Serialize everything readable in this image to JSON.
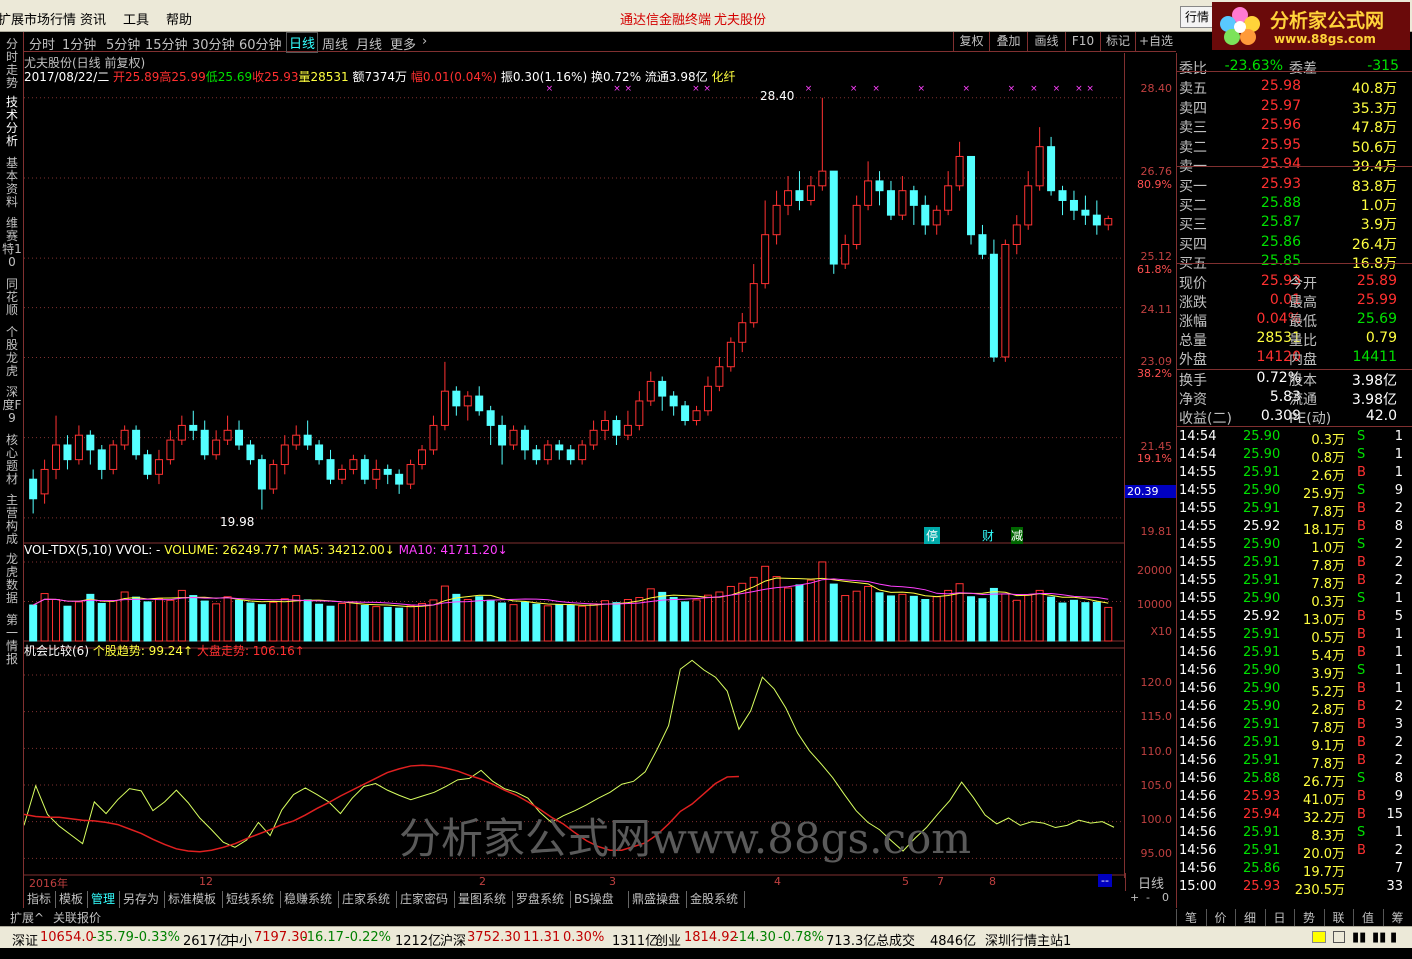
{
  "menu": {
    "items": [
      "扩展市场行情",
      "资讯",
      "工具",
      "帮助"
    ],
    "center_left": "通达信金融终端",
    "center_right": "尤夫股份",
    "quote_button": "行情"
  },
  "logo": {
    "title": "分析家公式网",
    "url": "www.88gs.com"
  },
  "left_tabs": [
    "分时走势",
    "技术分析",
    "基本资料",
    "维赛特10",
    "同花顺",
    "个股龙虎",
    "深度F9",
    "核心题材",
    "主营构成",
    "龙虎数据",
    "第一情报"
  ],
  "period_tabs": [
    "分时",
    "1分钟",
    "5分钟",
    "15分钟",
    "30分钟",
    "60分钟",
    "日线",
    "周线",
    "月线",
    "更多"
  ],
  "active_period": "日线",
  "tool_buttons": [
    "复权",
    "叠加",
    "画线",
    "F10",
    "标记",
    "+自选"
  ],
  "chart_title": "尤夫股份(日线 前复权)",
  "info_line": {
    "date": "2017/08/22/二",
    "open": "开25.89",
    "high": "高25.99",
    "low": "低25.69",
    "close": "收25.93",
    "vol": "量28531",
    "amt": "额7374万",
    "range": "幅0.01(0.04%)",
    "amp": "振0.30(1.16%)",
    "turn": "换0.72%",
    "float": "流通3.98亿",
    "concept": "化纤"
  },
  "price_axis": [
    "28.40",
    "26.76",
    "25.12",
    "24.11",
    "23.09",
    "21.45",
    "19.81"
  ],
  "fib_axis": [
    "80.9%",
    "61.8%",
    "38.2%",
    "19.1%"
  ],
  "current_price_tag": "20.39",
  "annotations": {
    "high": "28.40",
    "low": "19.98",
    "events": [
      "停",
      "财",
      "减"
    ]
  },
  "vol_header": {
    "name": "VOL-TDX(5,10)",
    "vvol": "VVOL: -",
    "volume": "VOLUME: 26249.77↑",
    "ma5": "MA5: 34212.00↓",
    "ma10": "MA10: 41711.20↓"
  },
  "vol_axis": [
    "20000",
    "10000",
    "X10"
  ],
  "ind_header": {
    "name": "机会比较(6)",
    "stock": "个股趋势: 99.24↑",
    "market": "大盘走势: 106.16↑"
  },
  "ind_axis": [
    "120.0",
    "115.0",
    "110.0",
    "105.0",
    "100.0",
    "95.00"
  ],
  "watermark": "分析家公式网www.88gs.com",
  "date_axis": [
    "2016年",
    "12",
    "2",
    "3",
    "4",
    "5",
    "7",
    "8"
  ],
  "bottom_tabs": [
    "指标",
    "模板",
    "管理",
    "另存为",
    "标准模板",
    "短线系统",
    "稳赚系统",
    "庄家系统",
    "庄家密码",
    "量图系统",
    "罗盘系统",
    "BS操盘",
    "鼎盛操盘",
    "金股系统"
  ],
  "active_bottom_tab": "管理",
  "ext_tabs": [
    "扩展^",
    "关联报价"
  ],
  "day_label": "日线",
  "order_book": {
    "weibi": {
      "label": "委比",
      "value": "-23.63%",
      "label2": "委差",
      "value2": "-315"
    },
    "sells": [
      {
        "name": "卖五",
        "price": "25.98",
        "vol": "40.8万"
      },
      {
        "name": "卖四",
        "price": "25.97",
        "vol": "35.3万"
      },
      {
        "name": "卖三",
        "price": "25.96",
        "vol": "47.8万"
      },
      {
        "name": "卖二",
        "price": "25.95",
        "vol": "50.6万"
      },
      {
        "name": "卖一",
        "price": "25.94",
        "vol": "39.4万"
      }
    ],
    "buys": [
      {
        "name": "买一",
        "price": "25.93",
        "vol": "83.8万"
      },
      {
        "name": "买二",
        "price": "25.88",
        "vol": "1.0万"
      },
      {
        "name": "买三",
        "price": "25.87",
        "vol": "3.9万"
      },
      {
        "name": "买四",
        "price": "25.86",
        "vol": "26.4万"
      },
      {
        "name": "买五",
        "price": "25.85",
        "vol": "16.8万"
      }
    ]
  },
  "quote": [
    {
      "l": "现价",
      "v": "25.93",
      "l2": "今开",
      "v2": "25.89"
    },
    {
      "l": "涨跌",
      "v": "0.01",
      "l2": "最高",
      "v2": "25.99"
    },
    {
      "l": "涨幅",
      "v": "0.04%",
      "l2": "最低",
      "v2": "25.69"
    },
    {
      "l": "总量",
      "v": "28531",
      "l2": "量比",
      "v2": "0.79"
    },
    {
      "l": "外盘",
      "v": "14120",
      "l2": "内盘",
      "v2": "14411"
    }
  ],
  "fund": [
    {
      "l": "换手",
      "v": "0.72%",
      "l2": "股本",
      "v2": "3.98亿"
    },
    {
      "l": "净资",
      "v": "5.83",
      "l2": "流通",
      "v2": "3.98亿"
    },
    {
      "l": "收益(二)",
      "v": "0.309",
      "l2": "PE(动)",
      "v2": "42.0"
    }
  ],
  "ticks": [
    [
      "14:54",
      "25.90",
      "0.3万",
      "S",
      "1"
    ],
    [
      "14:54",
      "25.90",
      "0.8万",
      "S",
      "1"
    ],
    [
      "14:55",
      "25.91",
      "2.6万",
      "B",
      "1"
    ],
    [
      "14:55",
      "25.90",
      "25.9万",
      "S",
      "9"
    ],
    [
      "14:55",
      "25.91",
      "7.8万",
      "B",
      "2"
    ],
    [
      "14:55",
      "25.92",
      "18.1万",
      "B",
      "8"
    ],
    [
      "14:55",
      "25.90",
      "1.0万",
      "S",
      "2"
    ],
    [
      "14:55",
      "25.91",
      "7.8万",
      "B",
      "2"
    ],
    [
      "14:55",
      "25.91",
      "7.8万",
      "B",
      "2"
    ],
    [
      "14:55",
      "25.90",
      "0.3万",
      "S",
      "1"
    ],
    [
      "14:55",
      "25.92",
      "13.0万",
      "B",
      "5"
    ],
    [
      "14:55",
      "25.91",
      "0.5万",
      "B",
      "1"
    ],
    [
      "14:56",
      "25.91",
      "5.4万",
      "B",
      "1"
    ],
    [
      "14:56",
      "25.90",
      "3.9万",
      "S",
      "1"
    ],
    [
      "14:56",
      "25.90",
      "5.2万",
      "B",
      "1"
    ],
    [
      "14:56",
      "25.90",
      "2.8万",
      "B",
      "2"
    ],
    [
      "14:56",
      "25.91",
      "7.8万",
      "B",
      "3"
    ],
    [
      "14:56",
      "25.91",
      "9.1万",
      "B",
      "2"
    ],
    [
      "14:56",
      "25.91",
      "7.8万",
      "B",
      "2"
    ],
    [
      "14:56",
      "25.88",
      "26.7万",
      "S",
      "8"
    ],
    [
      "14:56",
      "25.93",
      "41.0万",
      "B",
      "9"
    ],
    [
      "14:56",
      "25.94",
      "32.2万",
      "B",
      "15"
    ],
    [
      "14:56",
      "25.91",
      "8.3万",
      "S",
      "1"
    ],
    [
      "14:56",
      "25.91",
      "20.0万",
      "B",
      "2"
    ],
    [
      "14:56",
      "25.86",
      "19.7万",
      "",
      "7"
    ],
    [
      "15:00",
      "25.93",
      "230.5万",
      "",
      "33"
    ]
  ],
  "right_bottom_tabs": [
    "笔",
    "价",
    "细",
    "日",
    "势",
    "联",
    "值",
    "筹"
  ],
  "status": {
    "sz": {
      "name": "深证",
      "v": "10654.0",
      "c": "-35.79",
      "p": "-0.33%",
      "a": "2617亿"
    },
    "zx": {
      "name": "中小",
      "v": "7197.30",
      "c": "-16.17",
      "p": "-0.22%",
      "a": "1212亿"
    },
    "hs": {
      "name": "沪深",
      "v": "3752.30",
      "c": "11.31",
      "p": "0.30%",
      "a": "1311亿"
    },
    "cy": {
      "name": "创业",
      "v": "1814.92",
      "c": "-14.30",
      "p": "-0.78%",
      "a": "713.3亿"
    },
    "total": {
      "name": "总成交",
      "a": "4846亿"
    },
    "station": "深圳行情主站1"
  },
  "chart_data": {
    "type": "candlestick",
    "title": "尤夫股份(日线 前复权)",
    "price_range": [
      19.5,
      28.6
    ],
    "candles": [
      [
        20.6,
        20.2,
        20.8,
        19.9
      ],
      [
        20.3,
        20.8,
        21.0,
        20.1
      ],
      [
        20.8,
        21.3,
        21.9,
        20.6
      ],
      [
        21.3,
        21.0,
        21.5,
        20.8
      ],
      [
        21.0,
        21.5,
        21.7,
        20.9
      ],
      [
        21.5,
        21.2,
        21.6,
        20.9
      ],
      [
        21.2,
        20.8,
        21.3,
        20.6
      ],
      [
        20.8,
        21.3,
        21.4,
        20.7
      ],
      [
        21.3,
        21.6,
        21.7,
        21.2
      ],
      [
        21.6,
        21.1,
        21.7,
        21.0
      ],
      [
        21.1,
        20.7,
        21.2,
        20.6
      ],
      [
        20.7,
        21.0,
        21.2,
        20.5
      ],
      [
        21.0,
        21.4,
        21.6,
        20.9
      ],
      [
        21.4,
        21.7,
        21.9,
        21.3
      ],
      [
        21.7,
        21.6,
        22.0,
        21.4
      ],
      [
        21.6,
        21.1,
        21.8,
        21.0
      ],
      [
        21.1,
        21.4,
        21.6,
        21.0
      ],
      [
        21.4,
        21.6,
        21.9,
        21.3
      ],
      [
        21.6,
        21.3,
        21.8,
        21.2
      ],
      [
        21.3,
        21.0,
        21.4,
        20.9
      ],
      [
        21.0,
        20.4,
        21.1,
        19.98
      ],
      [
        20.4,
        20.9,
        21.0,
        20.3
      ],
      [
        20.9,
        21.3,
        21.5,
        20.7
      ],
      [
        21.3,
        21.5,
        21.7,
        21.2
      ],
      [
        21.5,
        21.3,
        21.8,
        21.2
      ],
      [
        21.3,
        21.0,
        21.4,
        20.9
      ],
      [
        21.0,
        20.6,
        21.2,
        20.5
      ],
      [
        20.6,
        20.8,
        20.9,
        20.5
      ],
      [
        20.8,
        21.0,
        21.1,
        20.7
      ],
      [
        21.0,
        20.6,
        21.1,
        20.5
      ],
      [
        20.6,
        20.8,
        21.0,
        20.4
      ],
      [
        20.8,
        20.7,
        20.9,
        20.5
      ],
      [
        20.7,
        20.5,
        20.8,
        20.3
      ],
      [
        20.5,
        20.9,
        21.0,
        20.4
      ],
      [
        20.9,
        21.2,
        21.3,
        20.8
      ],
      [
        21.2,
        21.7,
        21.9,
        21.1
      ],
      [
        21.7,
        22.4,
        23.0,
        21.6
      ],
      [
        22.4,
        22.1,
        22.5,
        21.9
      ],
      [
        22.1,
        22.3,
        22.4,
        21.8
      ],
      [
        22.3,
        22.0,
        22.5,
        21.9
      ],
      [
        22.0,
        21.7,
        22.1,
        21.3
      ],
      [
        21.7,
        21.3,
        21.9,
        20.9
      ],
      [
        21.3,
        21.6,
        21.7,
        21.2
      ],
      [
        21.6,
        21.2,
        21.7,
        21.0
      ],
      [
        21.2,
        21.0,
        21.3,
        20.9
      ],
      [
        21.0,
        21.3,
        21.4,
        20.9
      ],
      [
        21.3,
        21.2,
        21.4,
        21.0
      ],
      [
        21.2,
        21.0,
        21.3,
        20.9
      ],
      [
        21.0,
        21.3,
        21.4,
        20.9
      ],
      [
        21.3,
        21.6,
        21.8,
        21.2
      ],
      [
        21.6,
        21.8,
        22.0,
        21.4
      ],
      [
        21.8,
        21.5,
        21.9,
        21.3
      ],
      [
        21.5,
        21.7,
        22.0,
        21.4
      ],
      [
        21.7,
        22.2,
        22.4,
        21.6
      ],
      [
        22.2,
        22.6,
        22.8,
        22.1
      ],
      [
        22.6,
        22.3,
        22.7,
        22.0
      ],
      [
        22.3,
        22.1,
        22.4,
        21.9
      ],
      [
        22.1,
        21.8,
        22.2,
        21.7
      ],
      [
        21.8,
        22.0,
        22.1,
        21.7
      ],
      [
        22.0,
        22.5,
        22.7,
        21.9
      ],
      [
        22.5,
        22.9,
        23.1,
        22.4
      ],
      [
        22.9,
        23.4,
        23.5,
        22.8
      ],
      [
        23.4,
        23.8,
        24.0,
        23.2
      ],
      [
        23.8,
        24.6,
        25.0,
        23.7
      ],
      [
        24.6,
        25.6,
        26.3,
        24.5
      ],
      [
        25.6,
        26.2,
        26.5,
        25.4
      ],
      [
        26.2,
        26.5,
        26.8,
        26.0
      ],
      [
        26.5,
        26.3,
        26.9,
        26.1
      ],
      [
        26.3,
        26.6,
        26.8,
        26.2
      ],
      [
        26.6,
        26.9,
        28.4,
        26.5
      ],
      [
        26.9,
        25.0,
        26.9,
        24.8
      ],
      [
        25.0,
        25.4,
        25.6,
        24.9
      ],
      [
        25.4,
        26.2,
        26.4,
        25.3
      ],
      [
        26.2,
        26.7,
        27.1,
        26.1
      ],
      [
        26.7,
        26.5,
        26.9,
        26.2
      ],
      [
        26.5,
        26.0,
        26.7,
        25.9
      ],
      [
        26.0,
        26.5,
        26.8,
        25.9
      ],
      [
        26.5,
        26.2,
        26.6,
        25.8
      ],
      [
        26.2,
        25.8,
        26.4,
        25.6
      ],
      [
        25.8,
        26.1,
        26.2,
        25.6
      ],
      [
        26.1,
        26.6,
        26.9,
        26.0
      ],
      [
        26.6,
        27.2,
        27.5,
        26.5
      ],
      [
        27.2,
        25.6,
        27.2,
        25.4
      ],
      [
        25.6,
        25.2,
        25.8,
        25.1
      ],
      [
        25.2,
        23.1,
        25.5,
        23.0
      ],
      [
        23.1,
        25.4,
        25.5,
        23.0
      ],
      [
        25.4,
        25.8,
        26.0,
        25.2
      ],
      [
        25.8,
        26.6,
        26.9,
        25.7
      ],
      [
        26.6,
        27.4,
        27.8,
        26.5
      ],
      [
        27.4,
        26.5,
        27.6,
        26.4
      ],
      [
        26.5,
        26.3,
        26.6,
        26.0
      ],
      [
        26.3,
        26.1,
        26.5,
        25.9
      ],
      [
        26.1,
        26.0,
        26.4,
        25.8
      ],
      [
        26.0,
        25.8,
        26.3,
        25.6
      ],
      [
        25.8,
        25.93,
        25.99,
        25.69
      ]
    ],
    "volume": [
      9100,
      12000,
      10500,
      8800,
      9900,
      11800,
      9500,
      10200,
      12400,
      11100,
      9900,
      10700,
      10300,
      12800,
      11500,
      10100,
      9400,
      11200,
      10300,
      9600,
      9200,
      9800,
      10700,
      11500,
      10400,
      9300,
      8800,
      9500,
      9900,
      9000,
      8700,
      8500,
      8300,
      8900,
      9500,
      10400,
      13900,
      11800,
      10500,
      11200,
      10300,
      9600,
      9200,
      9800,
      9300,
      8900,
      9200,
      9000,
      8800,
      9400,
      10200,
      9700,
      10500,
      11000,
      13200,
      12300,
      11000,
      9900,
      10400,
      11600,
      12400,
      13800,
      14600,
      16100,
      18900,
      16300,
      13400,
      14200,
      15400,
      20000,
      14400,
      11500,
      12600,
      13800,
      12200,
      11400,
      11800,
      11300,
      10500,
      11200,
      12800,
      14500,
      11200,
      10700,
      13300,
      11900,
      10300,
      11600,
      12800,
      11100,
      9600,
      10300,
      9700,
      9800,
      8500
    ],
    "opportunity_stock": [
      99.5,
      104.9,
      101.0,
      99.4,
      98.2,
      97.0,
      102.7,
      101.1,
      103.0,
      104.5,
      104.2,
      101.5,
      102.7,
      104.3,
      102.6,
      100.5,
      98.9,
      97.2,
      96.5,
      97.5,
      99.9,
      98.1,
      101.6,
      103.7,
      104.6,
      103.7,
      102.7,
      101.1,
      103.2,
      104.8,
      105.2,
      104.3,
      103.6,
      103.0,
      103.5,
      104.0,
      104.8,
      105.7,
      105.9,
      107.0,
      105.5,
      104.5,
      104.0,
      103.2,
      101.3,
      99.9,
      100.8,
      101.5,
      102.3,
      103.2,
      104.0,
      105.1,
      105.5,
      106.8,
      109.8,
      113.1,
      120.8,
      122.0,
      120.7,
      119.7,
      117.8,
      112.6,
      115.1,
      119.7,
      118.1,
      115.5,
      112.1,
      109.7,
      107.9,
      106.0,
      103.7,
      101.5,
      99.9,
      98.9,
      97.4,
      96.0,
      97.7,
      99.2,
      101.1,
      102.9,
      105.4,
      103.3,
      100.9,
      99.7,
      100.5,
      99.5,
      100.0,
      99.8,
      99.2,
      99.5,
      100.2,
      99.8,
      100.0,
      99.24
    ],
    "opportunity_market": [
      101.0,
      100.7,
      100.6,
      100.6,
      100.4,
      100.2,
      100.1,
      99.9,
      99.6,
      99.0,
      98.4,
      97.6,
      96.9,
      96.3,
      96.0,
      95.9,
      96.1,
      96.5,
      97.0,
      97.7,
      98.3,
      98.9,
      99.6,
      100.1,
      100.9,
      101.8,
      102.6,
      103.5,
      104.3,
      105.1,
      105.9,
      106.7,
      107.2,
      107.6,
      107.7,
      107.6,
      107.3,
      106.9,
      106.3,
      105.8,
      105.1,
      104.3,
      103.6,
      102.7,
      101.7,
      100.6,
      99.7,
      98.5,
      97.4,
      96.6,
      96.1,
      96.1,
      96.6,
      97.1,
      98.2,
      99.7,
      101.4,
      102.4,
      103.8,
      105.2,
      106.1,
      106.16
    ]
  }
}
